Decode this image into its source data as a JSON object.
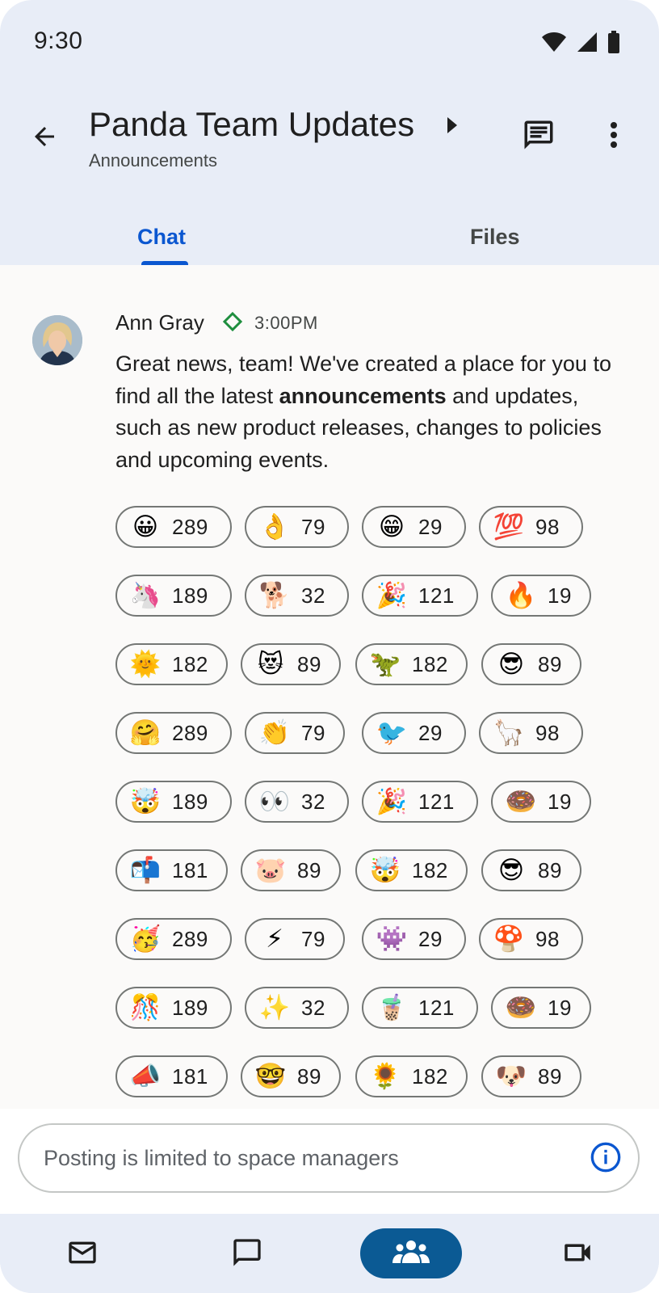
{
  "status_bar": {
    "time": "9:30",
    "icons": [
      "wifi-icon",
      "signal-icon",
      "battery-icon"
    ]
  },
  "header": {
    "title": "Panda Team Updates",
    "subtitle": "Announcements",
    "icons": {
      "back": "arrow-back-icon",
      "expand": "caret-right-icon",
      "threads": "message-icon",
      "more": "more-vert-icon"
    }
  },
  "tabs": [
    {
      "label": "Chat",
      "selected": true
    },
    {
      "label": "Files",
      "selected": false
    }
  ],
  "message": {
    "author": "Ann Gray",
    "time": "3:00PM",
    "text_before": "Great news, team! We've created a place for you to find all the latest ",
    "text_bold": "announcements",
    "text_after": " and updates, such as new product releases, changes to policies and upcoming events."
  },
  "reactions": [
    {
      "emoji": "😀",
      "count": "289"
    },
    {
      "emoji": "👌",
      "count": "79"
    },
    {
      "emoji": "😁",
      "count": "29"
    },
    {
      "emoji": "💯",
      "count": "98"
    },
    {
      "emoji": "🦄",
      "count": "189"
    },
    {
      "emoji": "🐕",
      "count": "32"
    },
    {
      "emoji": "🎉",
      "count": "121"
    },
    {
      "emoji": "🔥",
      "count": "19"
    },
    {
      "emoji": "🌞",
      "count": "182"
    },
    {
      "emoji": "😻",
      "count": "89"
    },
    {
      "emoji": "🦖",
      "count": "182"
    },
    {
      "emoji": "😎",
      "count": "89"
    },
    {
      "emoji": "🤗",
      "count": "289"
    },
    {
      "emoji": "👏",
      "count": "79"
    },
    {
      "emoji": "🐦",
      "count": "29"
    },
    {
      "emoji": "🦙",
      "count": "98"
    },
    {
      "emoji": "🤯",
      "count": "189"
    },
    {
      "emoji": "👀",
      "count": "32"
    },
    {
      "emoji": "🎉",
      "count": "121"
    },
    {
      "emoji": "🍩",
      "count": "19"
    },
    {
      "emoji": "📬",
      "count": "181"
    },
    {
      "emoji": "🐷",
      "count": "89"
    },
    {
      "emoji": "🤯",
      "count": "182"
    },
    {
      "emoji": "😎",
      "count": "89"
    },
    {
      "emoji": "🥳",
      "count": "289"
    },
    {
      "emoji": "⚡",
      "count": "79"
    },
    {
      "emoji": "👾",
      "count": "29"
    },
    {
      "emoji": "🍄",
      "count": "98"
    },
    {
      "emoji": "🎊",
      "count": "189"
    },
    {
      "emoji": "✨",
      "count": "32"
    },
    {
      "emoji": "🧋",
      "count": "121"
    },
    {
      "emoji": "🍩",
      "count": "19"
    },
    {
      "emoji": "📣",
      "count": "181"
    },
    {
      "emoji": "🤓",
      "count": "89"
    },
    {
      "emoji": "🌻",
      "count": "182"
    },
    {
      "emoji": "🐶",
      "count": "89"
    }
  ],
  "composer": {
    "placeholder": "Posting is limited to space managers",
    "icon": "info-icon"
  },
  "bottom_nav": [
    {
      "icon": "mail-icon",
      "selected": false
    },
    {
      "icon": "chat-icon",
      "selected": false
    },
    {
      "icon": "spaces-icon",
      "selected": true
    },
    {
      "icon": "video-icon",
      "selected": false
    }
  ],
  "colors": {
    "accent": "#0b57d0",
    "active_nav": "#0b5a94",
    "header_bg": "#e8edf7",
    "content_bg": "#fbfaf9",
    "badge": "#1e8e3e"
  }
}
